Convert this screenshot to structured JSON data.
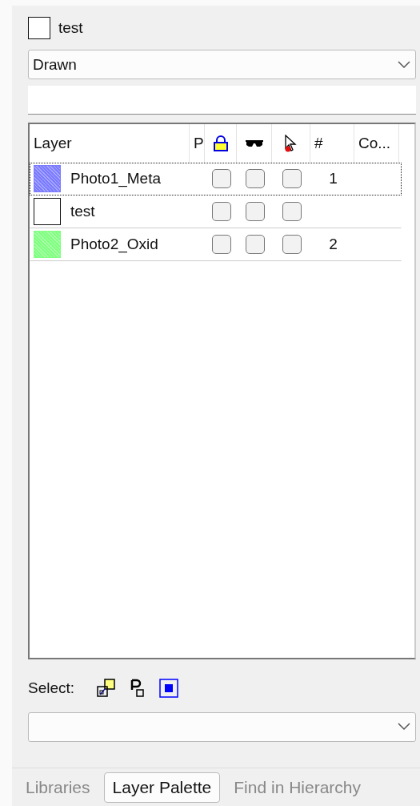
{
  "header": {
    "label": "test"
  },
  "view_dropdown": {
    "value": "Drawn"
  },
  "table": {
    "columns": [
      {
        "kind": "text",
        "label": "Layer"
      },
      {
        "kind": "text",
        "label": "P"
      },
      {
        "kind": "lock"
      },
      {
        "kind": "glasses"
      },
      {
        "kind": "cursor"
      },
      {
        "kind": "text",
        "label": "#"
      },
      {
        "kind": "text",
        "label": "Co..."
      }
    ],
    "rows": [
      {
        "name": "Photo1_Meta",
        "color": "#7b7bff",
        "selected": true,
        "locked": false,
        "visible": false,
        "selectable": false,
        "number": "1"
      },
      {
        "name": "test",
        "color": "#ffffff",
        "selected": false,
        "locked": false,
        "visible": false,
        "selectable": false
      },
      {
        "name": "Photo2_Oxid",
        "color": "#80ff80",
        "selected": false,
        "locked": false,
        "visible": false,
        "selectable": false,
        "number": "2"
      }
    ]
  },
  "select_bar": {
    "label": "Select:"
  },
  "tabs": [
    {
      "label": "Libraries",
      "selected": false
    },
    {
      "label": "Layer Palette",
      "selected": true
    },
    {
      "label": "Find in Hierarchy",
      "selected": false
    }
  ]
}
